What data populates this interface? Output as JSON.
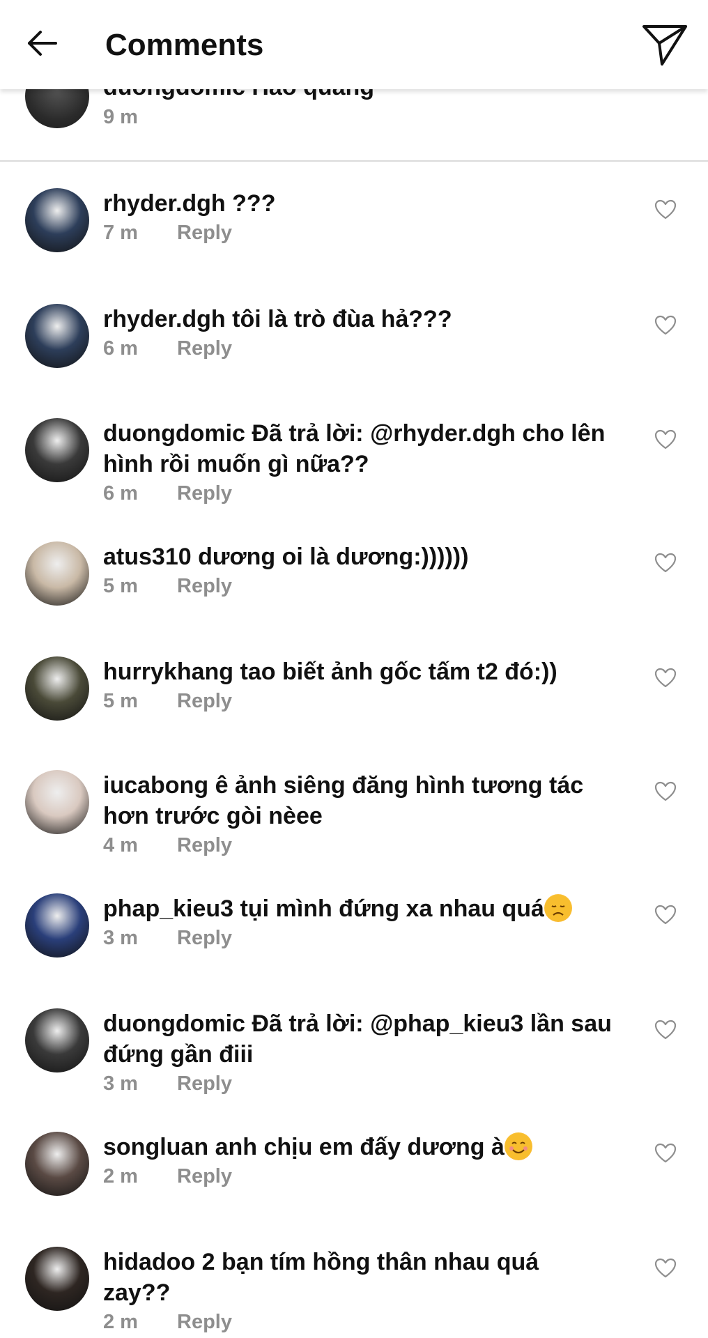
{
  "header": {
    "title": "Comments",
    "back_icon": "arrow-left-icon",
    "send_icon": "send-icon"
  },
  "previous_comment": {
    "text": "duongdomic Hào quang",
    "time": "9 m"
  },
  "reply_label": "Reply",
  "comments": [
    {
      "username": "rhyder.dgh",
      "text": "???",
      "time": "7 m",
      "avatar_color": "#2d3e5a"
    },
    {
      "username": "rhyder.dgh",
      "text": "tôi là trò đùa hả???",
      "time": "6 m",
      "avatar_color": "#2d3e5a"
    },
    {
      "username": "duongdomic",
      "text": "Đã trả lời: @rhyder.dgh cho lên hình rồi muốn gì nữa??",
      "time": "6 m",
      "avatar_color": "#3a3a3a"
    },
    {
      "username": "atus310",
      "text": "dương oi là dương:))))))",
      "time": "5 m",
      "avatar_color": "#c9b9a6"
    },
    {
      "username": "hurrykhang",
      "text": "tao biết ảnh gốc tấm t2 đó:))",
      "time": "5 m",
      "avatar_color": "#4a4a38"
    },
    {
      "username": "iucabong",
      "text": "ê ảnh siêng đăng hình tương tác hơn trước gòi nèee",
      "time": "4 m",
      "avatar_color": "#d9c9c0"
    },
    {
      "username": "phap_kieu3",
      "text": "tụi mình đứng xa nhau quá",
      "emoji": "disappointed-face-emoji",
      "time": "3 m",
      "avatar_color": "#2a3f7a"
    },
    {
      "username": "duongdomic",
      "text": "Đã trả lời: @phap_kieu3 lần sau đứng gần điii",
      "time": "3 m",
      "avatar_color": "#3a3a3a"
    },
    {
      "username": "songluan",
      "text": "anh chịu em đấy dương à",
      "emoji": "smiling-face-emoji",
      "time": "2 m",
      "avatar_color": "#5a4a44"
    },
    {
      "username": "hidadoo",
      "text": "2 bạn tím hồng thân nhau quá zay??",
      "time": "2 m",
      "avatar_color": "#2e2622"
    }
  ]
}
